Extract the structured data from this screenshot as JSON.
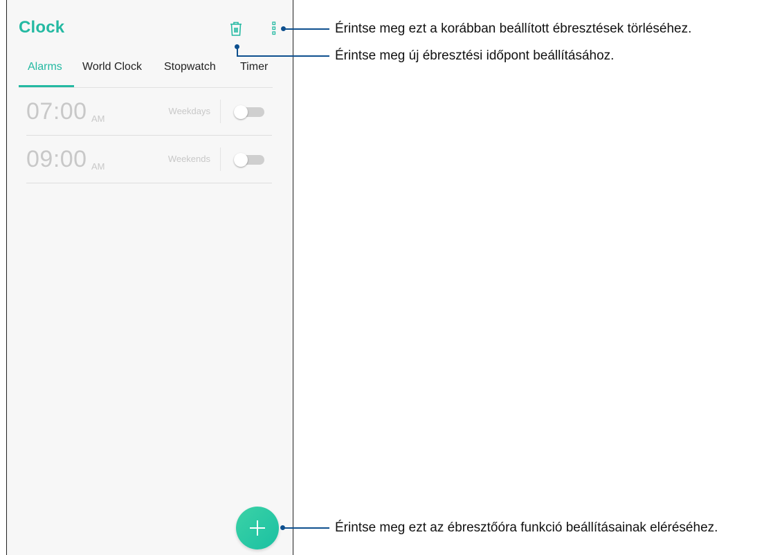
{
  "app": {
    "title": "Clock"
  },
  "toolbar": {
    "delete_icon": "trash-icon",
    "more_icon": "more-vertical-icon"
  },
  "tabs": [
    {
      "label": "Alarms",
      "active": true
    },
    {
      "label": "World Clock",
      "active": false
    },
    {
      "label": "Stopwatch",
      "active": false
    },
    {
      "label": "Timer",
      "active": false
    }
  ],
  "alarms": [
    {
      "time": "07:00",
      "ampm": "AM",
      "repeat": "Weekdays",
      "enabled": false
    },
    {
      "time": "09:00",
      "ampm": "AM",
      "repeat": "Weekends",
      "enabled": false
    }
  ],
  "fab": {
    "icon": "plus-icon"
  },
  "callouts": {
    "more_menu": "Érintse meg ezt a korábban beállított ébresztések törléséhez.",
    "delete": "Érintse meg új ébresztési időpont beállításához.",
    "add": "Érintse meg ezt az ébresztőóra funkció beállításainak eléréséhez."
  },
  "colors": {
    "accent": "#24b9a2",
    "callout": "#0d4f8e",
    "muted_text": "#c8c8c8"
  }
}
